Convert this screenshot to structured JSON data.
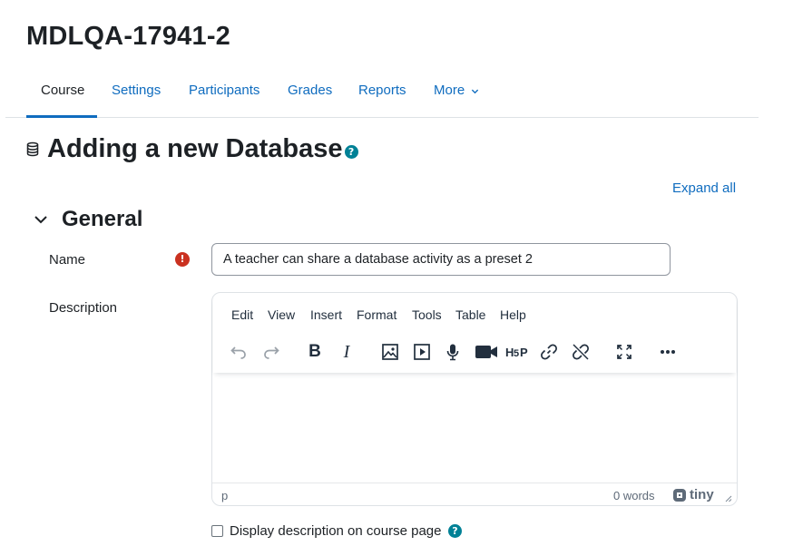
{
  "course": {
    "title": "MDLQA-17941-2"
  },
  "nav": {
    "items": [
      "Course",
      "Settings",
      "Participants",
      "Grades",
      "Reports",
      "More"
    ],
    "active": "Course"
  },
  "page": {
    "heading": "Adding a new Database",
    "heading_icon": "database-icon",
    "help_icon": "question-circle-icon"
  },
  "actions": {
    "expand_all": "Expand all"
  },
  "section": {
    "title": "General",
    "toggle_icon": "chevron-down-icon"
  },
  "form": {
    "name_label": "Name",
    "name_value": "A teacher can share a database activity as a preset 2",
    "required_icon": "exclamation-circle-icon",
    "description_label": "Description",
    "show_description_label": "Display description on course page",
    "show_description_checked": false
  },
  "editor": {
    "menus": [
      "Edit",
      "View",
      "Insert",
      "Format",
      "Tools",
      "Table",
      "Help"
    ],
    "toolbar_icons": [
      "undo-icon",
      "redo-icon",
      "bold-icon",
      "italic-icon",
      "image-icon",
      "media-icon",
      "record-audio-icon",
      "record-video-icon",
      "h5p-icon",
      "link-icon",
      "unlink-icon",
      "fullscreen-icon",
      "more-icon"
    ],
    "status_path": "p",
    "word_count": "0 words",
    "brand": "tiny"
  },
  "colors": {
    "link": "#0f6cbf",
    "help": "#008196",
    "required": "#ca3120",
    "text": "#1d2125"
  }
}
